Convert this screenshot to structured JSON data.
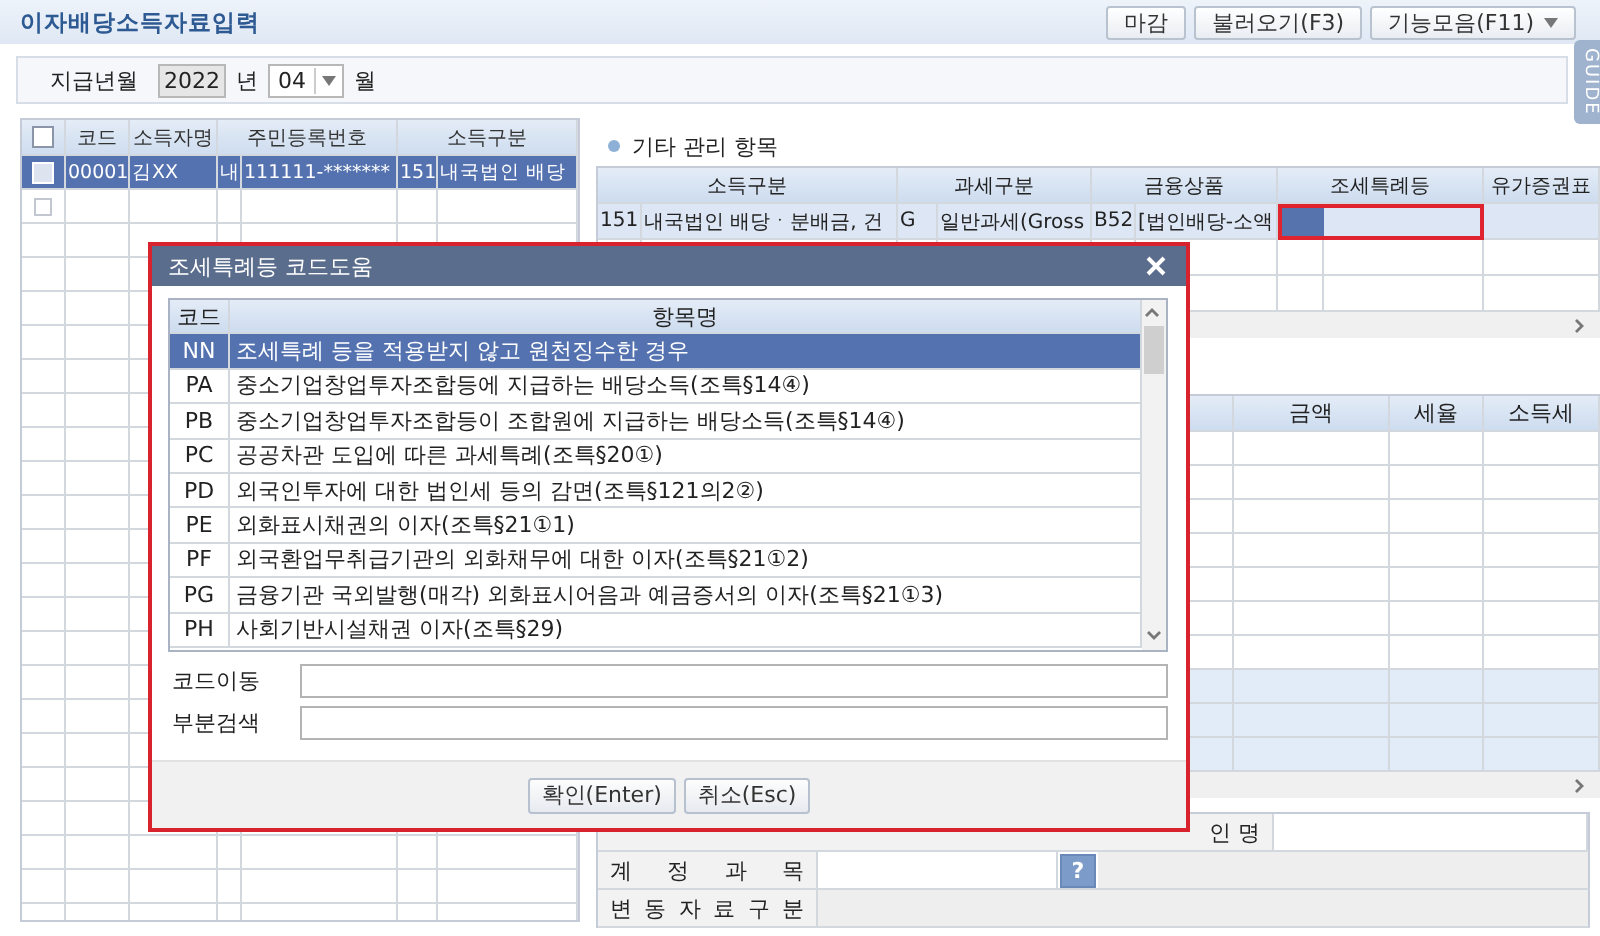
{
  "header": {
    "title": "이자배당소득자료입력",
    "buttons": [
      {
        "label": "마감",
        "has_menu": false
      },
      {
        "label": "불러오기(F3)",
        "has_menu": false
      },
      {
        "label": "기능모음(F11)",
        "has_menu": true
      }
    ]
  },
  "guide_tab": {
    "label": "GUIDE"
  },
  "period": {
    "label": "지급년월",
    "year": "2022",
    "year_unit": "년",
    "month": "04",
    "month_unit": "월"
  },
  "income_list": {
    "header_checked": false,
    "columns": [
      "코드",
      "소득자명",
      "주민등록번호",
      "소득구분"
    ],
    "rows": [
      {
        "checked": false,
        "selected": true,
        "code": "00001",
        "name": "김XX",
        "residency": "내",
        "id_number": "111111-*******",
        "income_code": "151",
        "income_type": "내국법인 배당"
      },
      {
        "checked": false,
        "selected": false
      }
    ]
  },
  "other_items": {
    "title": "기타 관리 항목",
    "columns": [
      "소득구분",
      "과세구분",
      "금융상품",
      "조세특례등",
      "유가증권표"
    ],
    "rows": [
      {
        "income_code": "151",
        "income_type": "내국법인 배당ㆍ분배금, 건",
        "tax_code": "G",
        "tax_type": "일반과세(Gross",
        "product_code": "B52",
        "product": "[법인배당-소액",
        "special_selected": true
      }
    ]
  },
  "amount_table": {
    "columns": [
      "금액",
      "세율",
      "소득세"
    ]
  },
  "detail_fields": [
    {
      "label": "인 명",
      "kind": "text"
    },
    {
      "label": "계 정 과 목",
      "kind": "lookup",
      "button": "?"
    },
    {
      "label": "변 동 자 료 구 분",
      "kind": "readonly"
    }
  ],
  "dialog": {
    "title": "조세특례등 코드도움",
    "columns": [
      "코드",
      "항목명"
    ],
    "rows": [
      {
        "code": "NN",
        "name": "조세특례 등을 적용받지 않고 원천징수한 경우",
        "selected": true
      },
      {
        "code": "PA",
        "name": "중소기업창업투자조합등에 지급하는 배당소득(조특§14④)",
        "selected": false
      },
      {
        "code": "PB",
        "name": "중소기업창업투자조합등이 조합원에 지급하는 배당소득(조특§14④)",
        "selected": false
      },
      {
        "code": "PC",
        "name": "공공차관 도입에 따른 과세특례(조특§20①)",
        "selected": false
      },
      {
        "code": "PD",
        "name": "외국인투자에 대한 법인세 등의 감면(조특§121의2②)",
        "selected": false
      },
      {
        "code": "PE",
        "name": "외화표시채권의 이자(조특§21①1)",
        "selected": false
      },
      {
        "code": "PF",
        "name": "외국환업무취급기관의 외화채무에 대한 이자(조특§21①2)",
        "selected": false
      },
      {
        "code": "PG",
        "name": "금융기관 국외발행(매각) 외화표시어음과 예금증서의 이자(조특§21①3)",
        "selected": false
      },
      {
        "code": "PH",
        "name": "사회기반시설채권 이자(조특§29)",
        "selected": false
      }
    ],
    "fields": [
      {
        "label": "코드이동"
      },
      {
        "label": "부분검색"
      }
    ],
    "buttons": [
      "확인(Enter)",
      "취소(Esc)"
    ]
  }
}
